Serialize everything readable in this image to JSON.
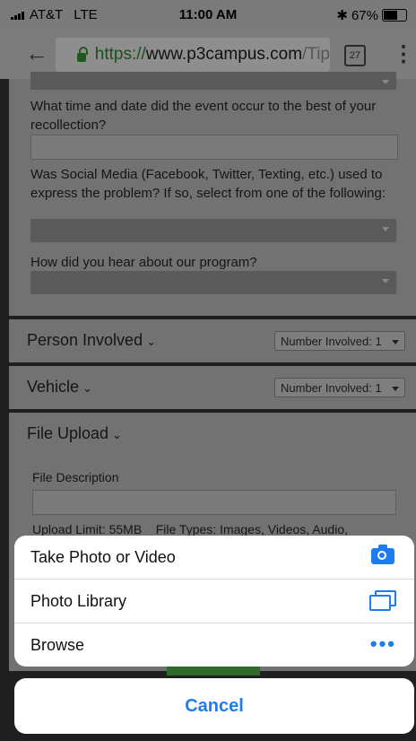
{
  "status_bar": {
    "carrier": "AT&T",
    "network": "LTE",
    "time": "11:00 AM",
    "bluetooth": "✱",
    "battery_text": "67%",
    "battery_level": 0.67
  },
  "browser": {
    "back_icon": "back-arrow-icon",
    "url_scheme": "https://",
    "url_host": "www.p3campus.com",
    "url_path": "/Tip",
    "tab_count": "27"
  },
  "form": {
    "q_time": "What time and date did the event occur to the best of your recollection?",
    "q_social": "Was Social Media (Facebook, Twitter, Texting, etc.) used to express the problem? If so, select from one of the following:",
    "q_heard": "How did you hear about our program?"
  },
  "sections": {
    "person": {
      "title": "Person Involved",
      "chevron": "⌄",
      "number_label": "Number Involved: 1"
    },
    "vehicle": {
      "title": "Vehicle",
      "chevron": "⌄",
      "number_label": "Number Involved: 1"
    },
    "file": {
      "title": "File Upload",
      "chevron": "⌄",
      "desc_label": "File Description",
      "limits": "Upload Limit: 55MB    File Types: Images, Videos, Audio,"
    }
  },
  "action_sheet": {
    "items": [
      {
        "label": "Take Photo or Video",
        "icon": "camera-icon"
      },
      {
        "label": "Photo Library",
        "icon": "photo-library-icon"
      },
      {
        "label": "Browse",
        "icon": "more-dots-icon"
      }
    ],
    "cancel": "Cancel"
  },
  "colors": {
    "ios_blue": "#1e7cf2",
    "lock_green": "#1e5a1e"
  }
}
